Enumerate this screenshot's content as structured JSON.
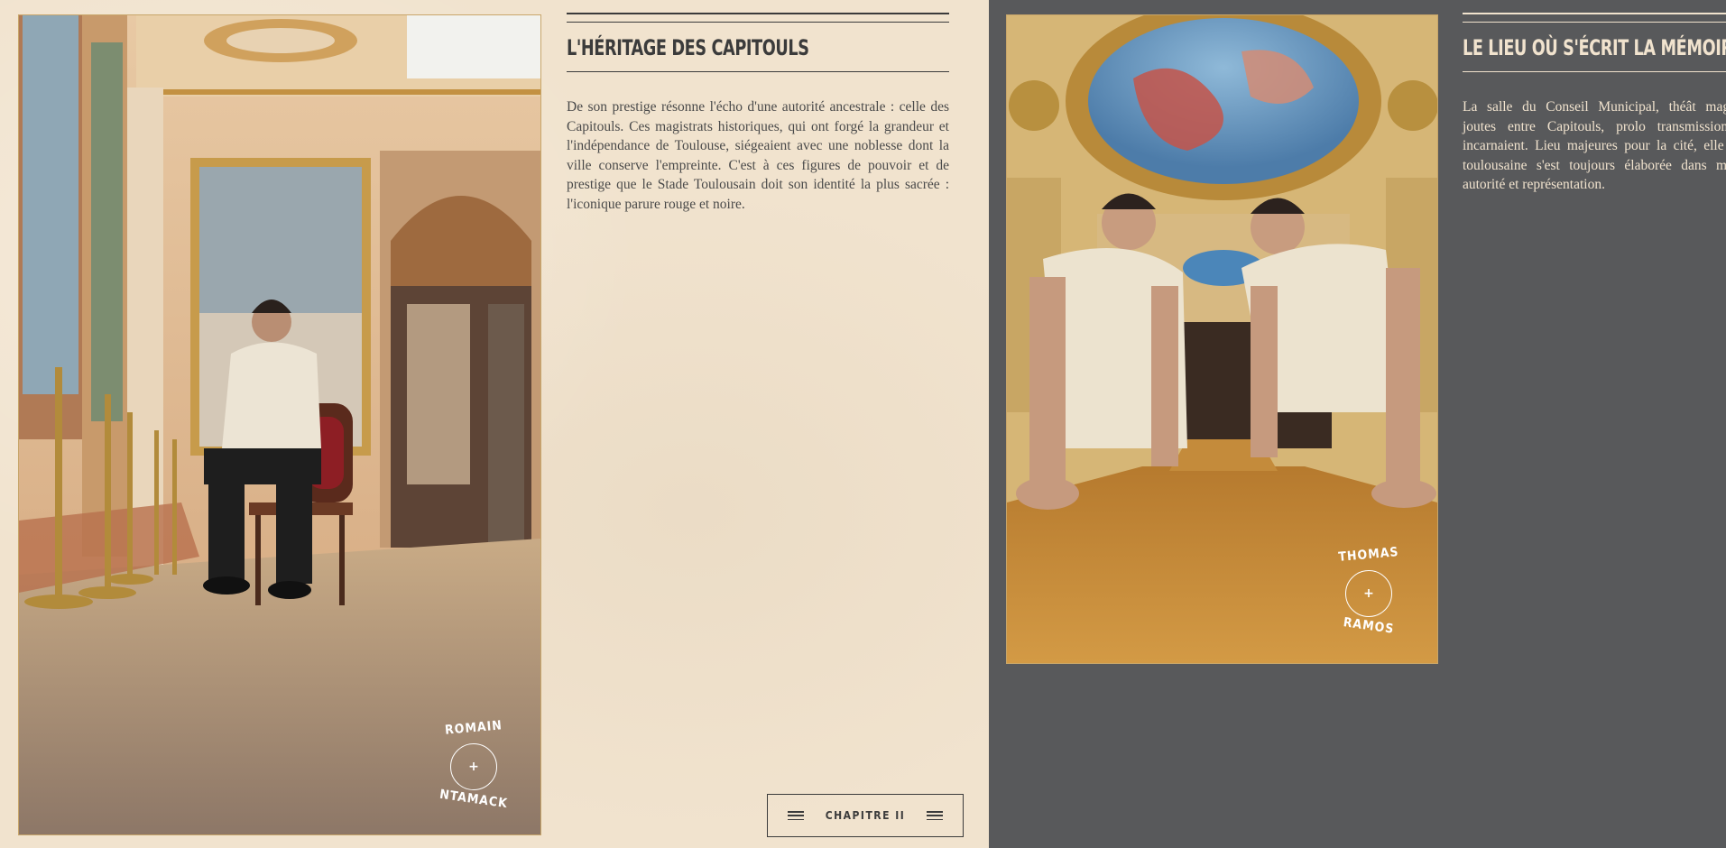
{
  "section_1": {
    "heading": "L'HÉRITAGE DES CAPITOULS",
    "body": "De son prestige résonne l'écho d'une autorité ancestrale : celle des Capitouls. Ces magistrats historiques, qui ont forgé la grandeur et l'indépendance de Toulouse, siégeaient avec une noblesse dont la ville conserve l'empreinte. C'est à ces figures de pouvoir et de prestige que le Stade Toulousain doit son identité la plus sacrée : l'iconique parure rouge et noire.",
    "player_badge": {
      "first_name": "ROMAIN",
      "last_name": "NTAMACK",
      "plus": "+"
    }
  },
  "section_2": {
    "heading": "LE LIEU OÙ S'ÉCRIT LA MÉMOIR",
    "body": "La salle du Conseil Municipal, théât magistrales joutes entre Capitouls, prolo transmission qu'ils incarnaient. Lieu majeures pour la cité, elle rappell toulousaine s'est toujours élaborée dans mémoire, autorité et représentation.",
    "player_badge": {
      "first_name": "THOMAS",
      "last_name": "RAMOS",
      "plus": "+"
    }
  },
  "chapter_nav": {
    "label": "CHAPITRE II",
    "left_icon": "menu-lines-icon",
    "right_icon": "menu-lines-icon"
  },
  "colors": {
    "cream": "#f1e3ce",
    "charcoal": "#58595b",
    "ink": "#3b3b3b",
    "gold_border": "#c8a66a"
  }
}
